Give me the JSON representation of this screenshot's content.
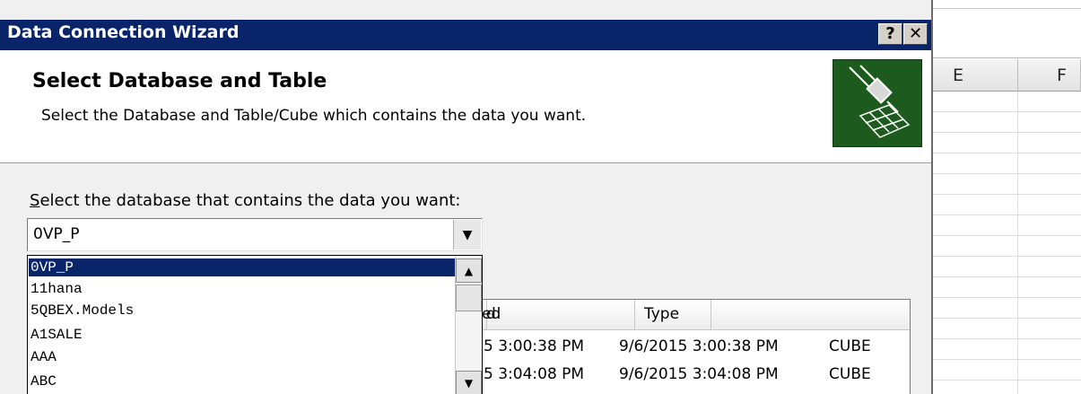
{
  "dialog": {
    "title": "Data Connection Wizard",
    "help_label": "?",
    "close_label": "✕",
    "heading": "Select Database and Table",
    "subheading": "Select the Database and Table/Cube which contains the data you want."
  },
  "database": {
    "label_accesskey": "S",
    "label_rest": "elect the database that contains the data you want:",
    "selected": "0VP_P",
    "options": [
      "0VP_P",
      "11hana",
      "5QBEX.Models",
      "A1SALE",
      "AAA",
      "ABC"
    ]
  },
  "table": {
    "headers": [
      "d",
      "Created",
      "Type"
    ],
    "rows": [
      {
        "modified": "5 3:00:38 PM",
        "created": "9/6/2015 3:00:38 PM",
        "type": "CUBE"
      },
      {
        "modified": "5 3:04:08 PM",
        "created": "9/6/2015 3:04:08 PM",
        "type": "CUBE"
      }
    ]
  },
  "excel": {
    "columns": [
      "E",
      "F"
    ]
  },
  "colors": {
    "titlebar": "#0a246a",
    "selection": "#0a246a",
    "dialog_bg": "#f0f0f0",
    "icon_bg": "#1d5a1d"
  },
  "icons": [
    "help-icon",
    "close-icon",
    "wizard-plug-icon",
    "dropdown-arrow-icon",
    "scroll-up-icon",
    "scroll-down-icon"
  ]
}
